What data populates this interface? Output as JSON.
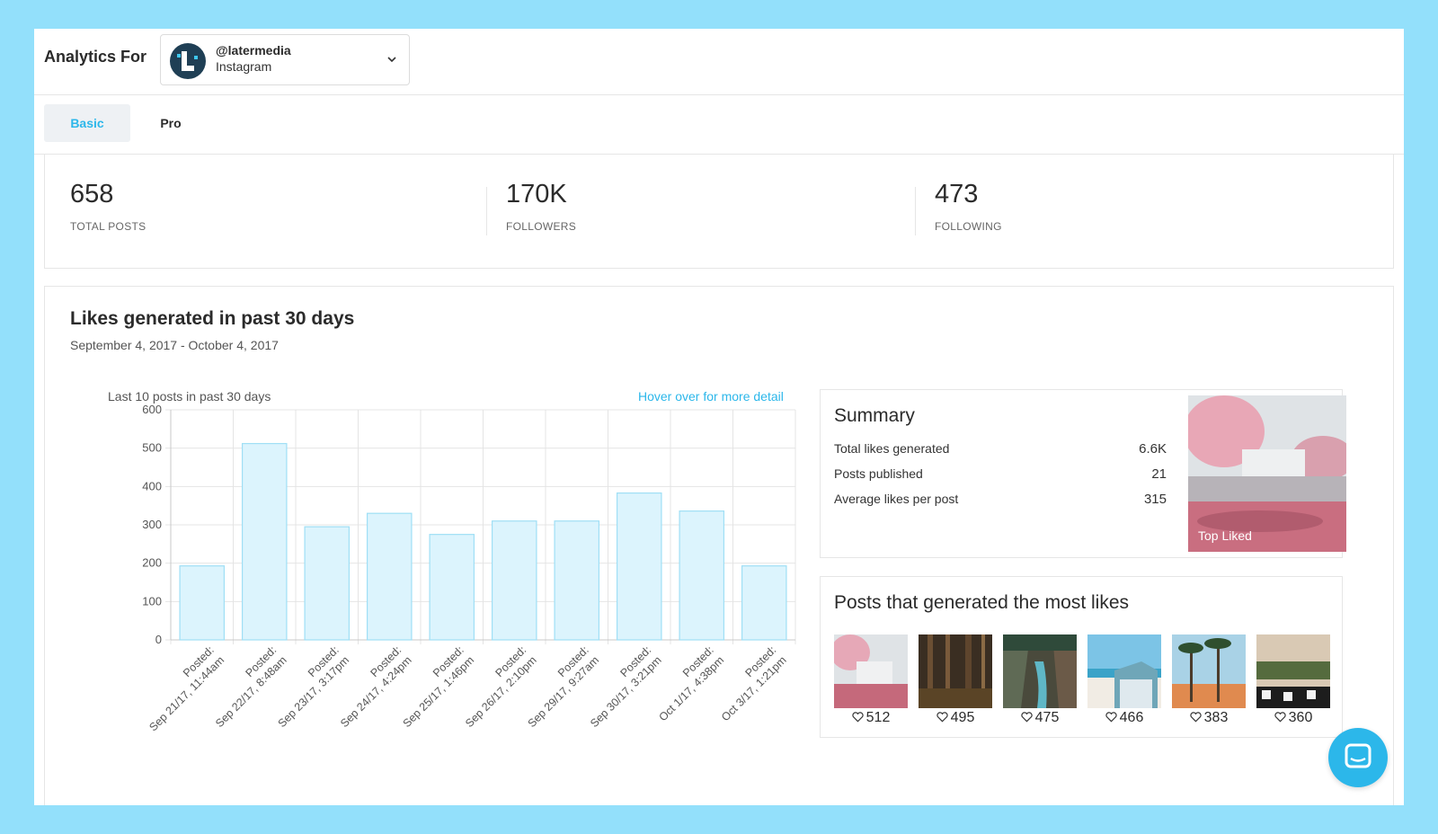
{
  "header": {
    "label": "Analytics For",
    "account": {
      "handle": "@latermedia",
      "platform": "Instagram"
    }
  },
  "tabs": [
    {
      "label": "Basic",
      "active": true
    },
    {
      "label": "Pro",
      "active": false
    }
  ],
  "stats": [
    {
      "value": "658",
      "label": "TOTAL POSTS"
    },
    {
      "value": "170K",
      "label": "FOLLOWERS"
    },
    {
      "value": "473",
      "label": "FOLLOWING"
    }
  ],
  "likes_card": {
    "title": "Likes generated in past 30 days",
    "date_range": "September 4, 2017 - October 4, 2017",
    "chart_caption": "Last 10 posts in past 30 days",
    "hover_hint": "Hover over for more detail"
  },
  "chart_data": {
    "type": "bar",
    "categories": [
      "Posted: Sep 21/17, 11:44am",
      "Posted: Sep 22/17, 8:48am",
      "Posted: Sep 23/17, 3:17pm",
      "Posted: Sep 24/17, 4:24pm",
      "Posted: Sep 25/17, 1:46pm",
      "Posted: Sep 26/17, 2:10pm",
      "Posted: Sep 29/17, 9:27am",
      "Posted: Sep 30/17, 3:21pm",
      "Posted: Oct 1/17, 4:38pm",
      "Posted: Oct 3/17, 1:21pm"
    ],
    "values": [
      193,
      512,
      295,
      330,
      275,
      310,
      310,
      383,
      336,
      193
    ],
    "yticks": [
      0,
      100,
      200,
      300,
      400,
      500,
      600
    ],
    "ylim": [
      0,
      600
    ],
    "grid": true,
    "bar_fill": "#dcf4fd",
    "bar_stroke": "#9fdff5"
  },
  "summary": {
    "title": "Summary",
    "rows": [
      {
        "label": "Total likes generated",
        "value": "6.6K"
      },
      {
        "label": "Posts published",
        "value": "21"
      },
      {
        "label": "Average likes per post",
        "value": "315"
      }
    ],
    "top_liked_label": "Top Liked"
  },
  "most_liked": {
    "title": "Posts that generated the most likes",
    "posts": [
      {
        "likes": "512"
      },
      {
        "likes": "495"
      },
      {
        "likes": "475"
      },
      {
        "likes": "466"
      },
      {
        "likes": "383"
      },
      {
        "likes": "360"
      }
    ]
  },
  "colors": {
    "accent": "#2cb7ea",
    "background": "#93e0fb"
  }
}
